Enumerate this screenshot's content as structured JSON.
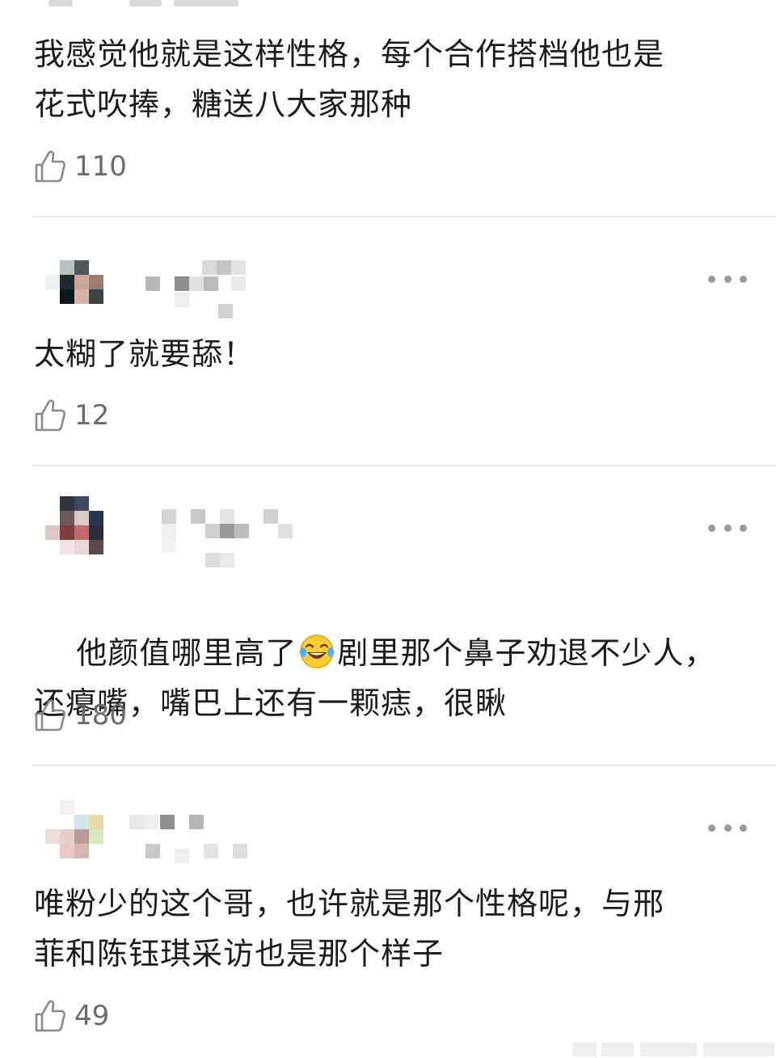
{
  "comments": [
    {
      "text": "我感觉他就是这样性格，每个合作搭档他也是\n花式吹捧，糖送八大家那种",
      "likes": "110"
    },
    {
      "text": "太糊了就要舔！",
      "likes": "12"
    },
    {
      "text_before_emoji": "他颜值哪里高了",
      "emoji": "laughing-with-tears-emoji",
      "text_after_emoji": "剧里那个鼻子劝退不少人，\n还瘪嘴，嘴巴上还有一颗痣，很瞅",
      "likes": "180"
    },
    {
      "text": "唯粉少的这个哥，也许就是那个性格呢，与邢\n菲和陈钰琪采访也是那个样子",
      "likes": "49"
    }
  ],
  "icons": {
    "like": "thumbs-up-icon",
    "more": "more-options-icon"
  },
  "colors": {
    "text": "#1c1c1c",
    "like_count": "#6b6b6b",
    "icon": "#8a8a8a",
    "divider": "#e6e6e6"
  }
}
